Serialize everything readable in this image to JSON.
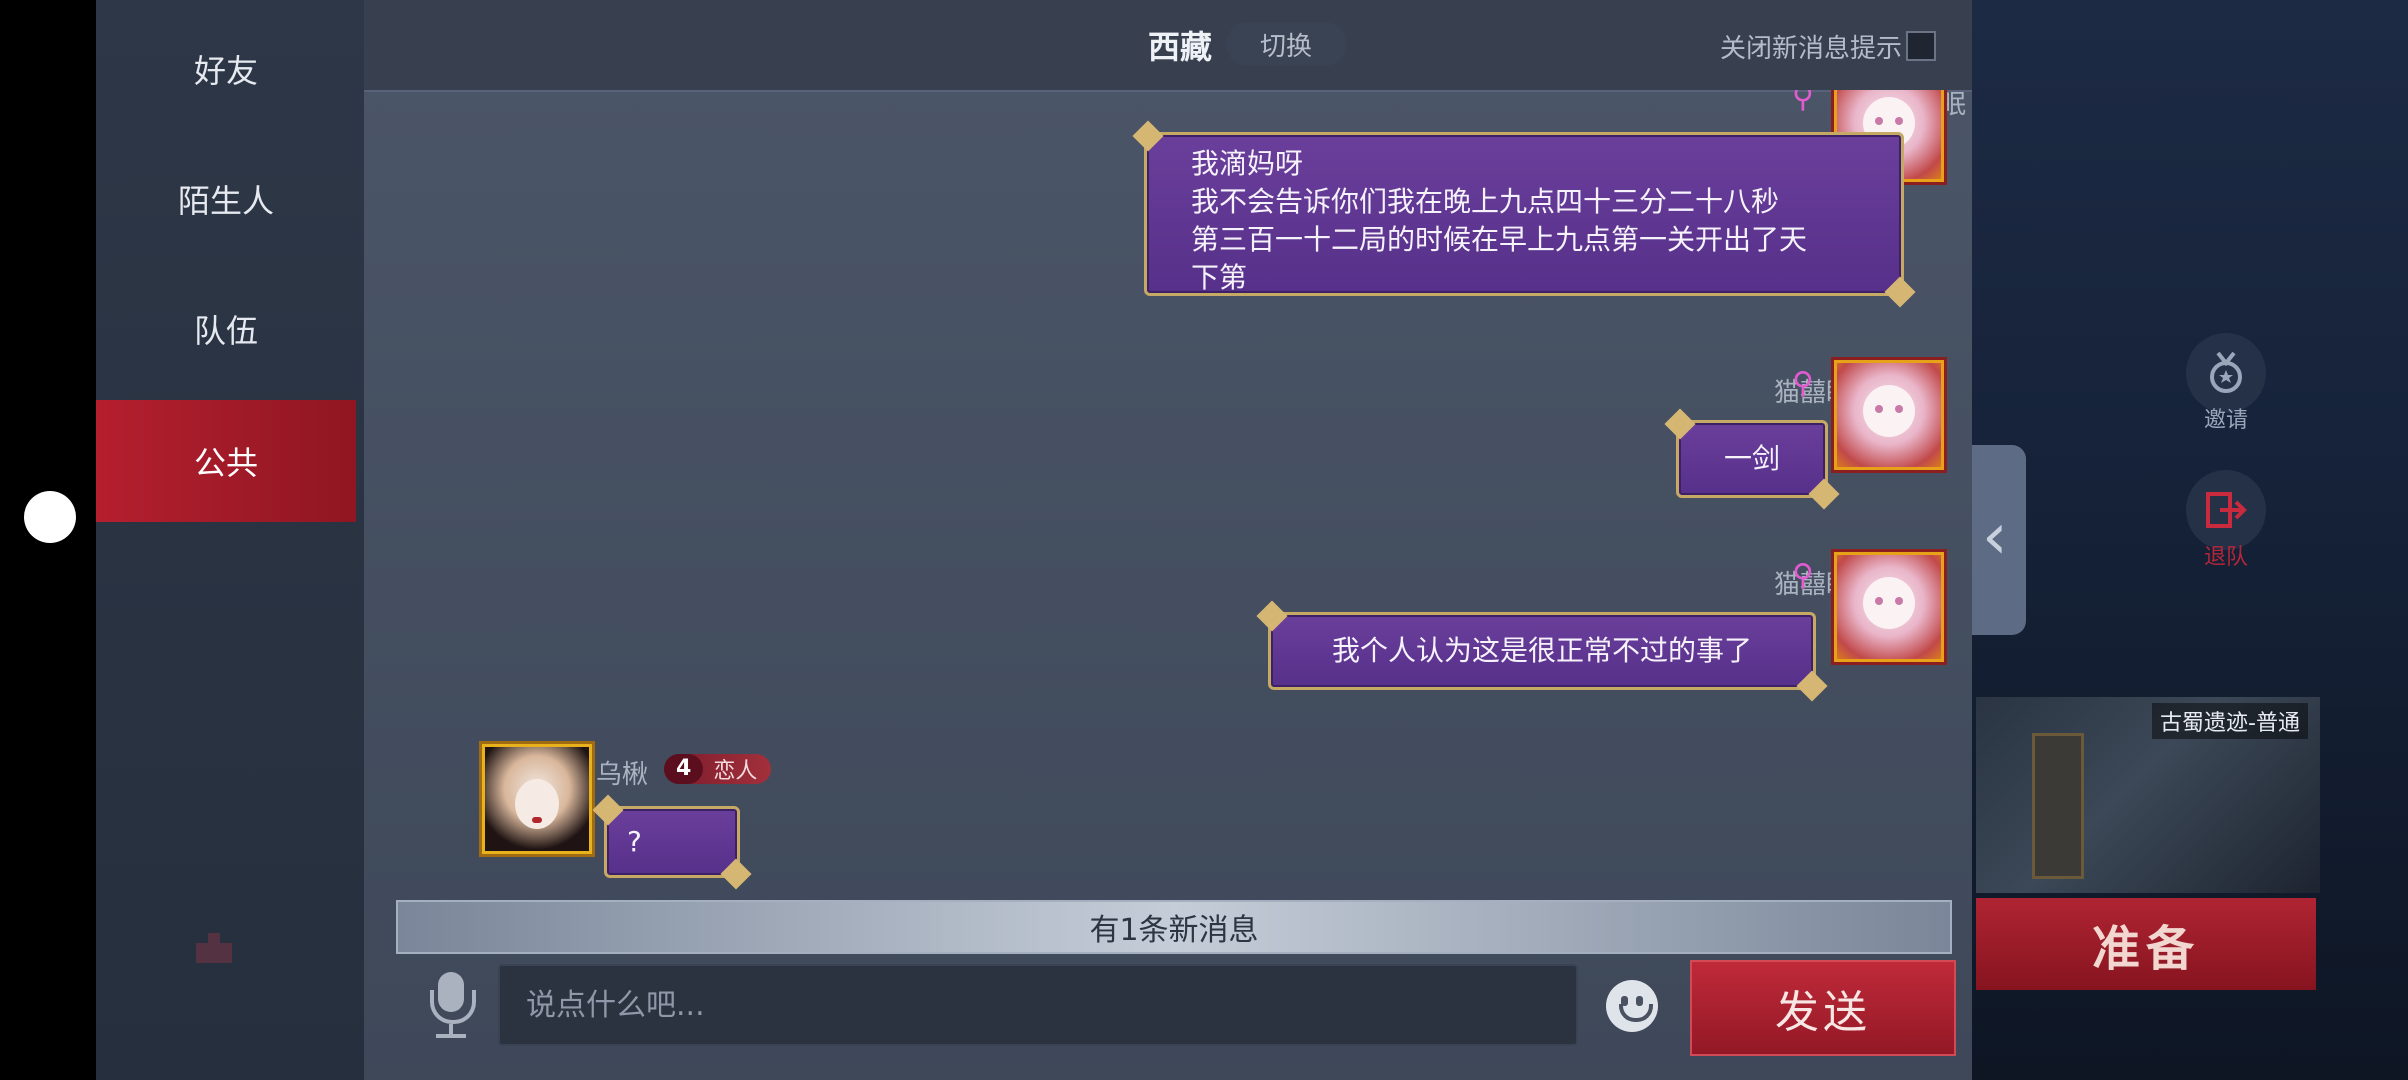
{
  "sidebar": {
    "tabs": [
      {
        "label": "好友"
      },
      {
        "label": "陌生人"
      },
      {
        "label": "队伍"
      },
      {
        "label": "公共"
      }
    ],
    "active_tab": "公共"
  },
  "header": {
    "channel": "西藏",
    "switch_label": "切换",
    "mute_label": "关闭新消息提示"
  },
  "messages": [
    {
      "sender": "猫囍眠",
      "direction": "outgoing",
      "lines": [
        "我滴妈呀",
        "我不会告诉你们我在晚上九点四十三分二十八秒",
        "第三百一十二局的时候在早上九点第一关开出了天",
        "下第"
      ]
    },
    {
      "sender": "猫囍眠",
      "direction": "outgoing",
      "lines": [
        "一剑"
      ]
    },
    {
      "sender": "猫囍眠",
      "direction": "outgoing",
      "lines": [
        "我个人认为这是很正常不过的事了"
      ]
    },
    {
      "sender": "乌楸",
      "direction": "incoming",
      "level": "4",
      "relation": "恋人",
      "lines": [
        "?"
      ]
    }
  ],
  "new_message_banner": "有1条新消息",
  "composer": {
    "placeholder": "说点什么吧...",
    "value": "",
    "send_label": "发送"
  },
  "game_sidebar": {
    "invite_label": "邀请",
    "leave_label": "退队",
    "map_name": "古蜀遗迹-普通",
    "ready_label": "准备"
  },
  "icons": {
    "name_tag": "key-icon",
    "mic": "microphone-icon",
    "emoji": "smiley-icon",
    "invite": "medal-icon",
    "leave": "exit-icon",
    "collapse": "chevron-left-icon"
  },
  "colors": {
    "active_tab": "#b51f2e",
    "bubble": "#5e3592",
    "bubble_border": "#c7a966",
    "send_button": "#b02433"
  }
}
